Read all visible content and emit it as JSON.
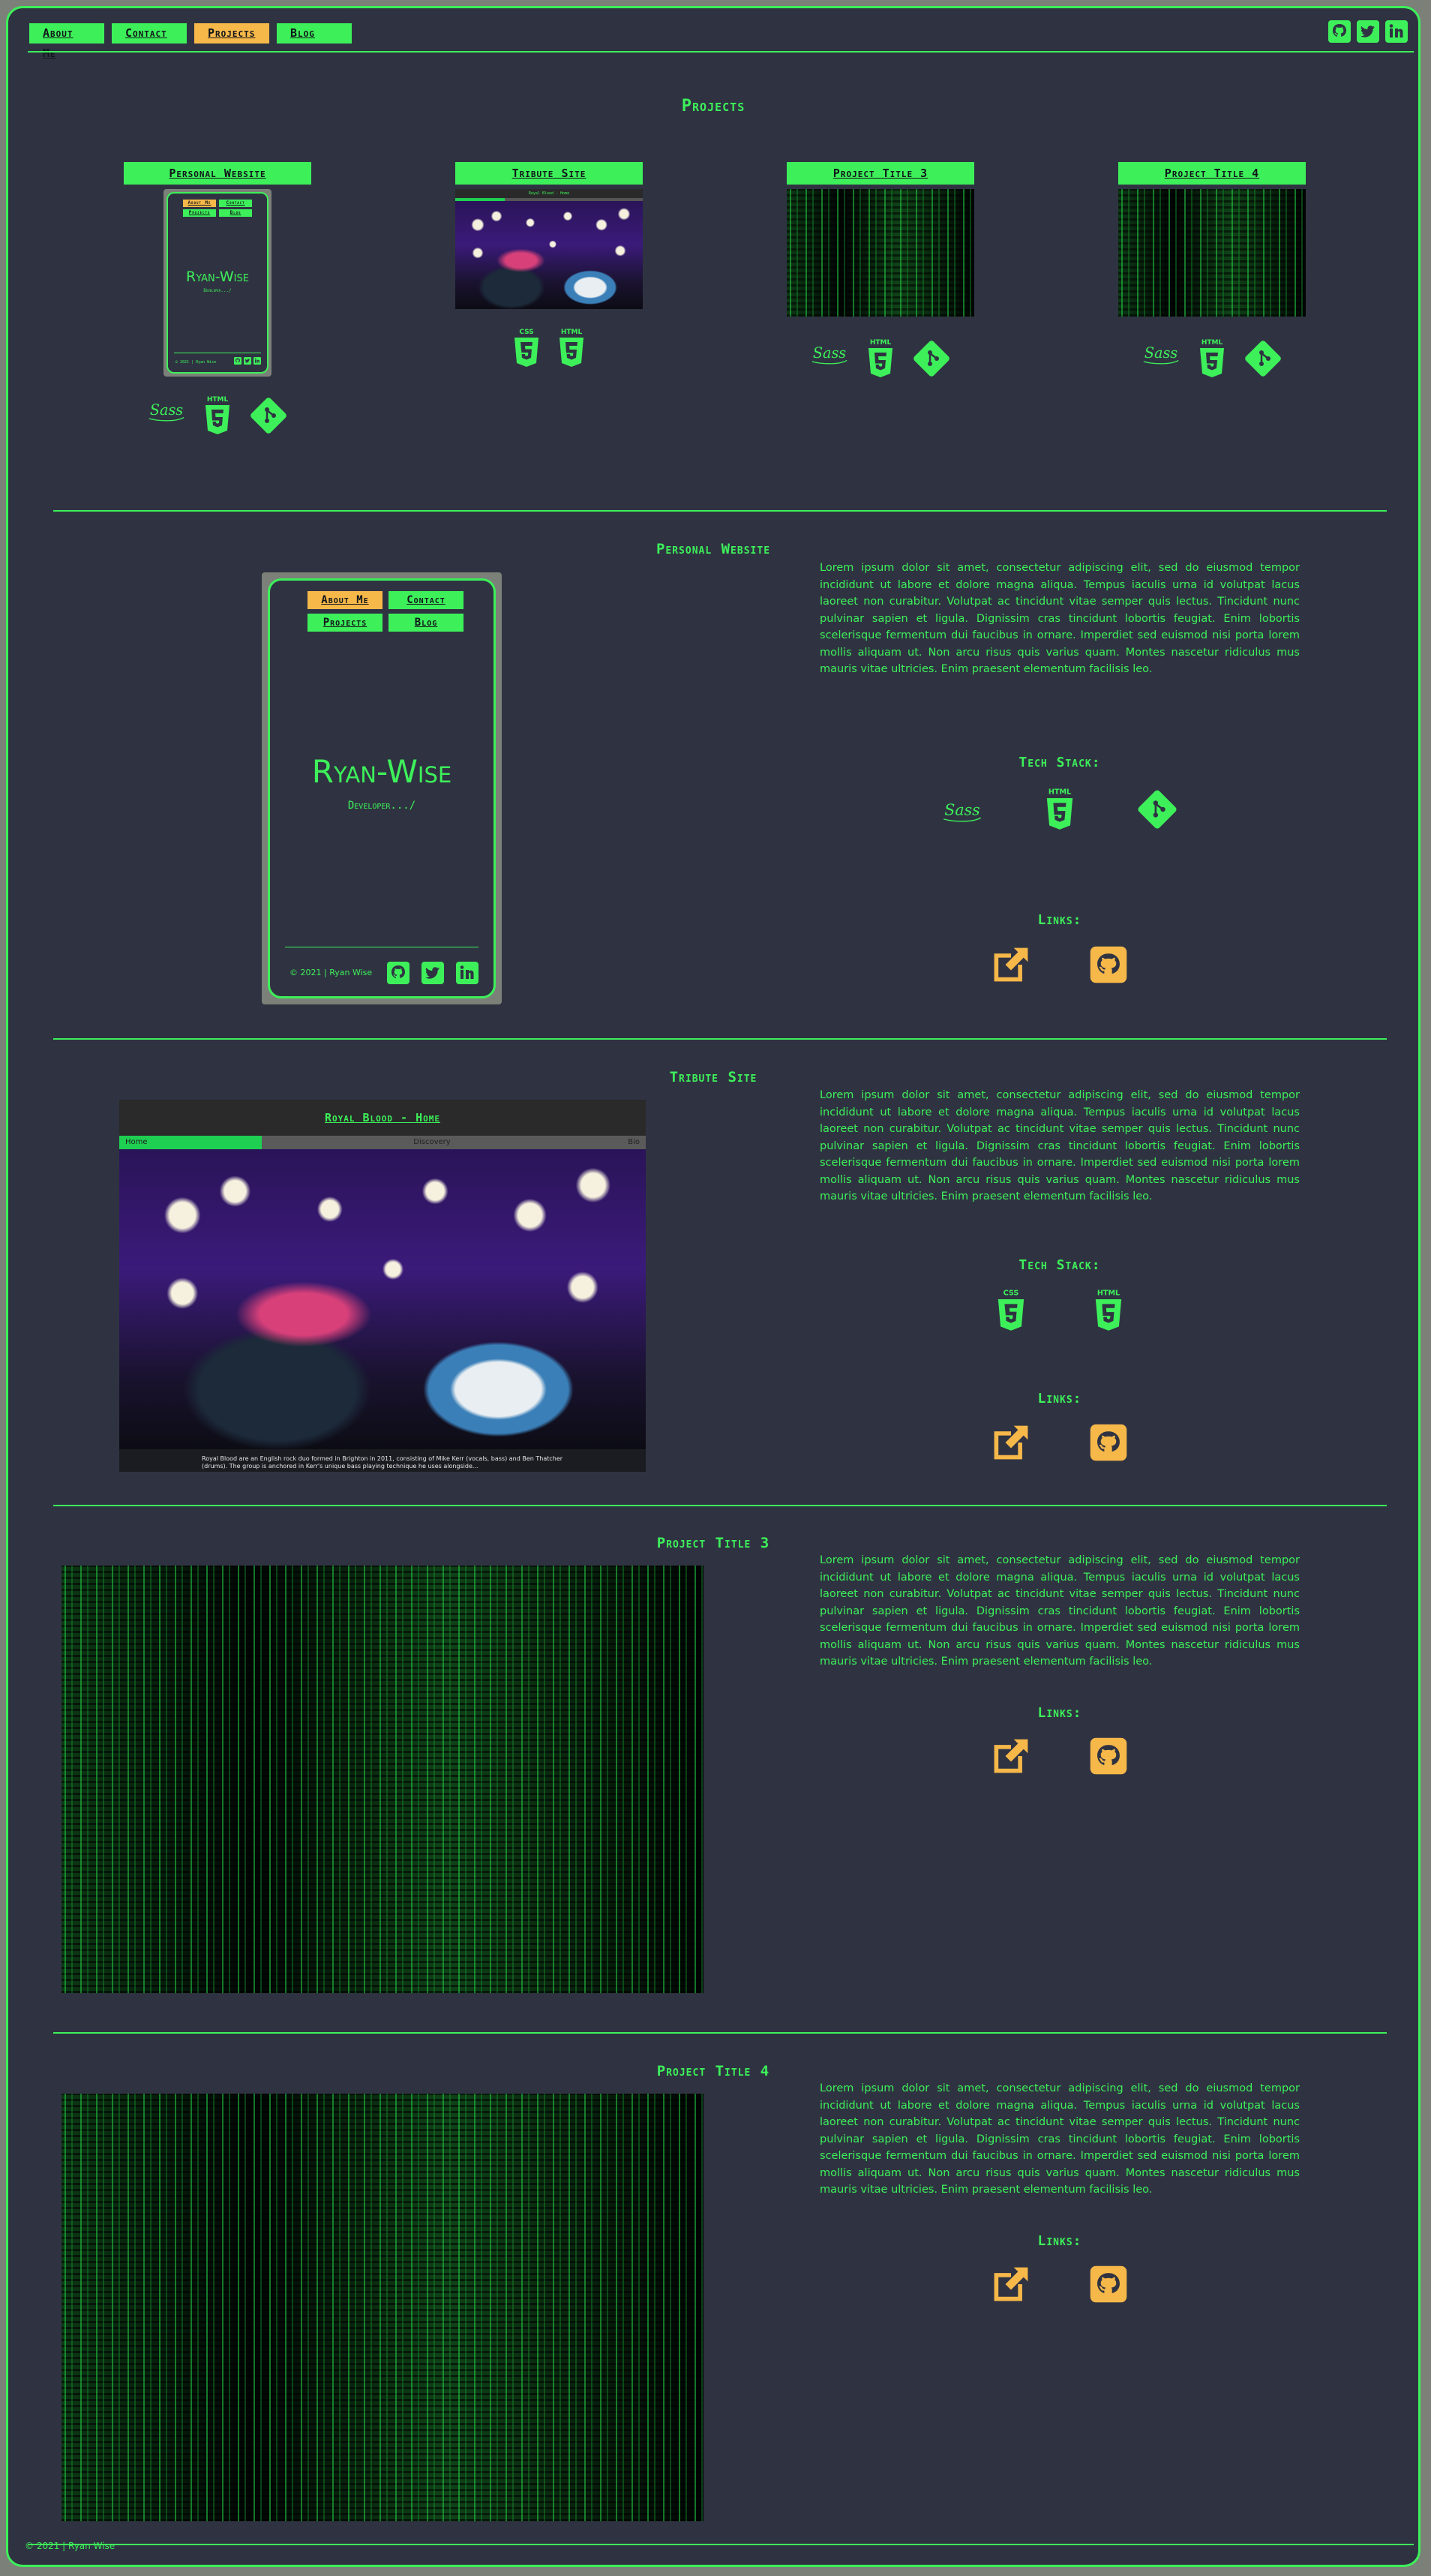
{
  "nav": {
    "items": [
      "About Me",
      "Contact",
      "Projects",
      "Blog"
    ],
    "active": "Projects"
  },
  "page_title": "Projects",
  "projects": [
    {
      "label": "Personal Website"
    },
    {
      "label": "Tribute Site"
    },
    {
      "label": "Project Title 3"
    },
    {
      "label": "Project Title 4"
    }
  ],
  "mini_phone": {
    "buttons": [
      "About Me",
      "Contact",
      "Projects",
      "Blog"
    ],
    "name": "Ryan-Wise",
    "tagline": "Developer.../",
    "footer": "© 2021 | Ryan Wise"
  },
  "mini_tribute": {
    "title": "Royal Blood - Home"
  },
  "lorem": "Lorem ipsum dolor sit amet, consectetur adipiscing elit, sed do eiusmod tempor incididunt ut labore et dolore magna aliqua. Tempus iaculis urna id volutpat lacus laoreet non curabitur. Volutpat ac tincidunt vitae semper quis lectus. Tincidunt nunc pulvinar sapien et ligula. Dignissim cras tincidunt lobortis feugiat. Enim lobortis scelerisque fermentum dui faucibus in ornare. Imperdiet sed euismod nisi porta lorem mollis aliquam ut. Non arcu risus quis varius quam. Montes nascetur ridiculus mus mauris vitae ultricies. Enim praesent elementum facilisis leo.",
  "sections": {
    "personal": {
      "title": "Personal Website",
      "tech_label": "Tech Stack:",
      "links_label": "Links:"
    },
    "tribute": {
      "title": "Tribute Site",
      "tech_label": "Tech Stack:",
      "links_label": "Links:",
      "site_title": "Royal Blood - Home",
      "tabs": [
        "Home",
        "Discovery",
        "Bio"
      ],
      "caption": "Royal Blood are an English rock duo formed in Brighton in 2011, consisting of Mike Kerr (vocals, bass) and Ben Thatcher (drums). The group is anchored in Kerr's unique bass playing technique he uses alongside..."
    },
    "p3": {
      "title": "Project Title 3",
      "links_label": "Links:"
    },
    "p4": {
      "title": "Project Title 4",
      "links_label": "Links:"
    }
  },
  "icons": {
    "social": [
      "github-icon",
      "twitter-icon",
      "linkedin-icon"
    ],
    "tech": [
      "sass-icon",
      "html5-icon",
      "git-icon",
      "css3-icon"
    ],
    "links": [
      "external-link-icon",
      "github-icon"
    ]
  },
  "tech_labels": {
    "html": "HTML",
    "css": "CSS",
    "sass": "Sass"
  },
  "footer": "© 2021 | Ryan Wise",
  "colors": {
    "background": "#2f3341",
    "accent": "#3df05a",
    "highlight": "#f7b84a",
    "outer": "#7b8078"
  }
}
